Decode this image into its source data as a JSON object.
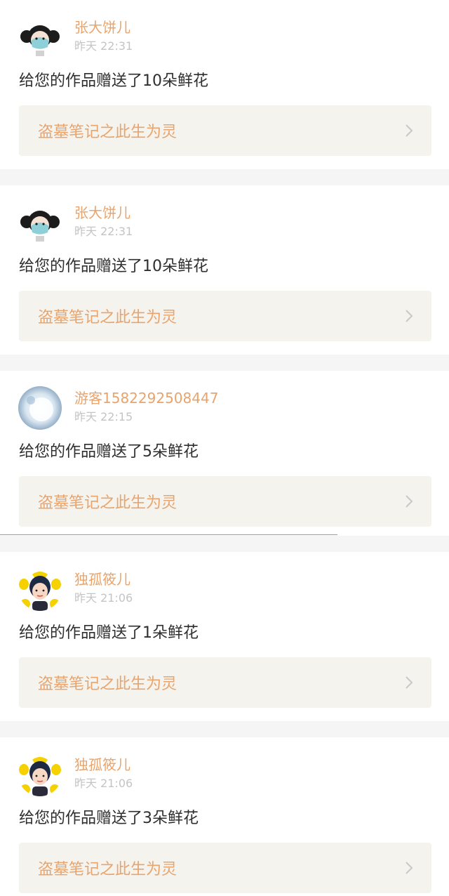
{
  "notifications": [
    {
      "avatar_icon": "masked-girl-avatar-icon",
      "username": "张大饼儿",
      "time": "昨天 22:31",
      "message": "给您的作品赠送了10朵鲜花",
      "work_title": "盗墓笔记之此生为灵"
    },
    {
      "avatar_icon": "masked-girl-avatar-icon",
      "username": "张大饼儿",
      "time": "昨天 22:31",
      "message": "给您的作品赠送了10朵鲜花",
      "work_title": "盗墓笔记之此生为灵"
    },
    {
      "avatar_icon": "moon-avatar-icon",
      "username": "游客1582292508447",
      "time": "昨天 22:15",
      "message": "给您的作品赠送了5朵鲜花",
      "work_title": "盗墓笔记之此生为灵"
    },
    {
      "avatar_icon": "cartoon-girl-avatar-icon",
      "username": "独孤筱儿",
      "time": "昨天 21:06",
      "message": "给您的作品赠送了1朵鲜花",
      "work_title": "盗墓笔记之此生为灵"
    },
    {
      "avatar_icon": "cartoon-girl-avatar-icon",
      "username": "独孤筱儿",
      "time": "昨天 21:06",
      "message": "给您的作品赠送了3朵鲜花",
      "work_title": "盗墓笔记之此生为灵"
    }
  ],
  "colors": {
    "accent": "#e8a46c",
    "text": "#2e2e2e",
    "time": "#c4c4c4",
    "link_bg": "#f5f3ee",
    "page_bg": "#f5f5f5"
  }
}
